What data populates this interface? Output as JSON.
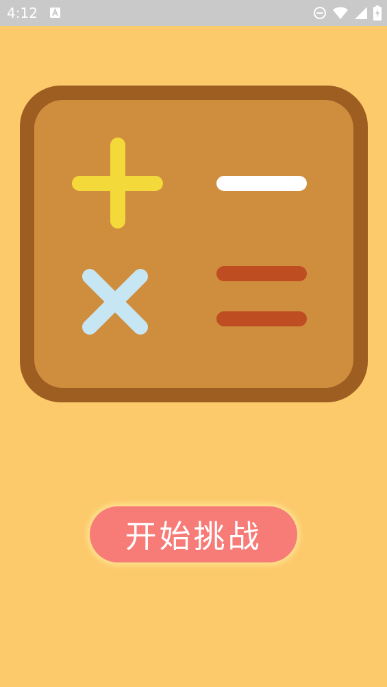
{
  "status_bar": {
    "time": "4:12",
    "notification_icon": "a-box-icon",
    "icons": [
      "do-not-disturb-icon",
      "wifi-icon",
      "cellular-signal-icon",
      "battery-charging-icon"
    ]
  },
  "illustration": {
    "symbols": [
      "plus-icon",
      "minus-icon",
      "multiply-icon",
      "equals-icon"
    ],
    "colors": {
      "board_outer": "#9E5E22",
      "board_inner": "#CF8D3E",
      "plus": "#F4D93A",
      "minus": "#FFFFFF",
      "multiply": "#C6E6F4",
      "equals": "#BE4D22"
    }
  },
  "start_button": {
    "label": "开始挑战",
    "color": "#F77C78"
  },
  "background": "#FCCA6B"
}
